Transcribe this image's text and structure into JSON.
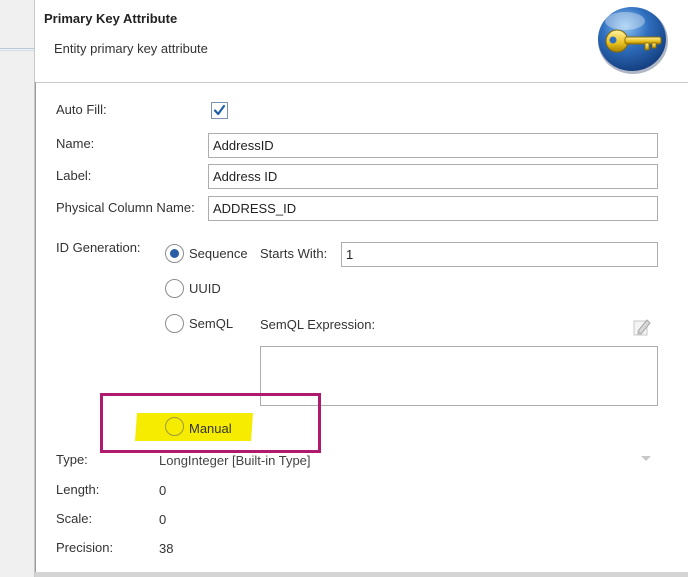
{
  "dialog": {
    "title": "Primary Key Attribute",
    "subtitle": "Entity primary key attribute",
    "header_icon": "key-icon"
  },
  "form": {
    "auto_fill": {
      "label": "Auto Fill:",
      "checked": true
    },
    "name": {
      "label": "Name:",
      "value": "AddressID"
    },
    "label_field": {
      "label": "Label:",
      "value": "Address ID"
    },
    "physical_column": {
      "label": "Physical Column Name:",
      "value": "ADDRESS_ID"
    },
    "id_generation": {
      "label": "ID Generation:",
      "options": [
        {
          "label": "Sequence",
          "selected": true
        },
        {
          "label": "UUID",
          "selected": false
        },
        {
          "label": "SemQL",
          "selected": false
        },
        {
          "label": "Manual",
          "selected": false
        }
      ],
      "starts_with": {
        "label": "Starts With:",
        "value": "1"
      },
      "semql_expression": {
        "label": "SemQL Expression:",
        "value": ""
      }
    },
    "type": {
      "label": "Type:",
      "value": "LongInteger [Built-in Type]"
    },
    "length": {
      "label": "Length:",
      "value": "0"
    },
    "scale": {
      "label": "Scale:",
      "value": "0"
    },
    "precision": {
      "label": "Precision:",
      "value": "38"
    }
  },
  "colors": {
    "highlight": "#f6ec00",
    "annotation_box": "#b01a6e",
    "radio_selected": "#2a5fa5",
    "checkmark": "#1f5fa8"
  }
}
